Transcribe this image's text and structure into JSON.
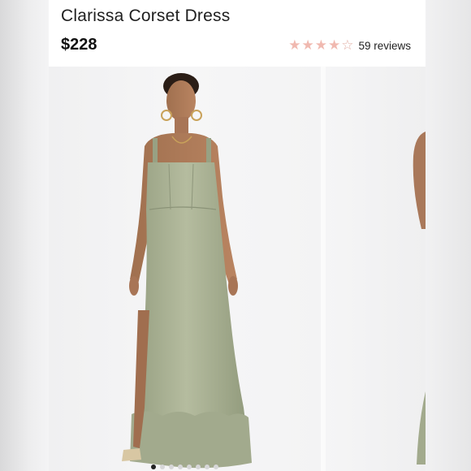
{
  "product": {
    "title": "Clarissa Corset Dress",
    "price": "$228",
    "rating": 4,
    "rating_max": 5,
    "reviews_label": "59 reviews"
  },
  "gallery": {
    "slide_count": 8,
    "active_index": 0
  },
  "colors": {
    "star_color": "#f0b9b0",
    "dress_color": "#a8b094"
  }
}
